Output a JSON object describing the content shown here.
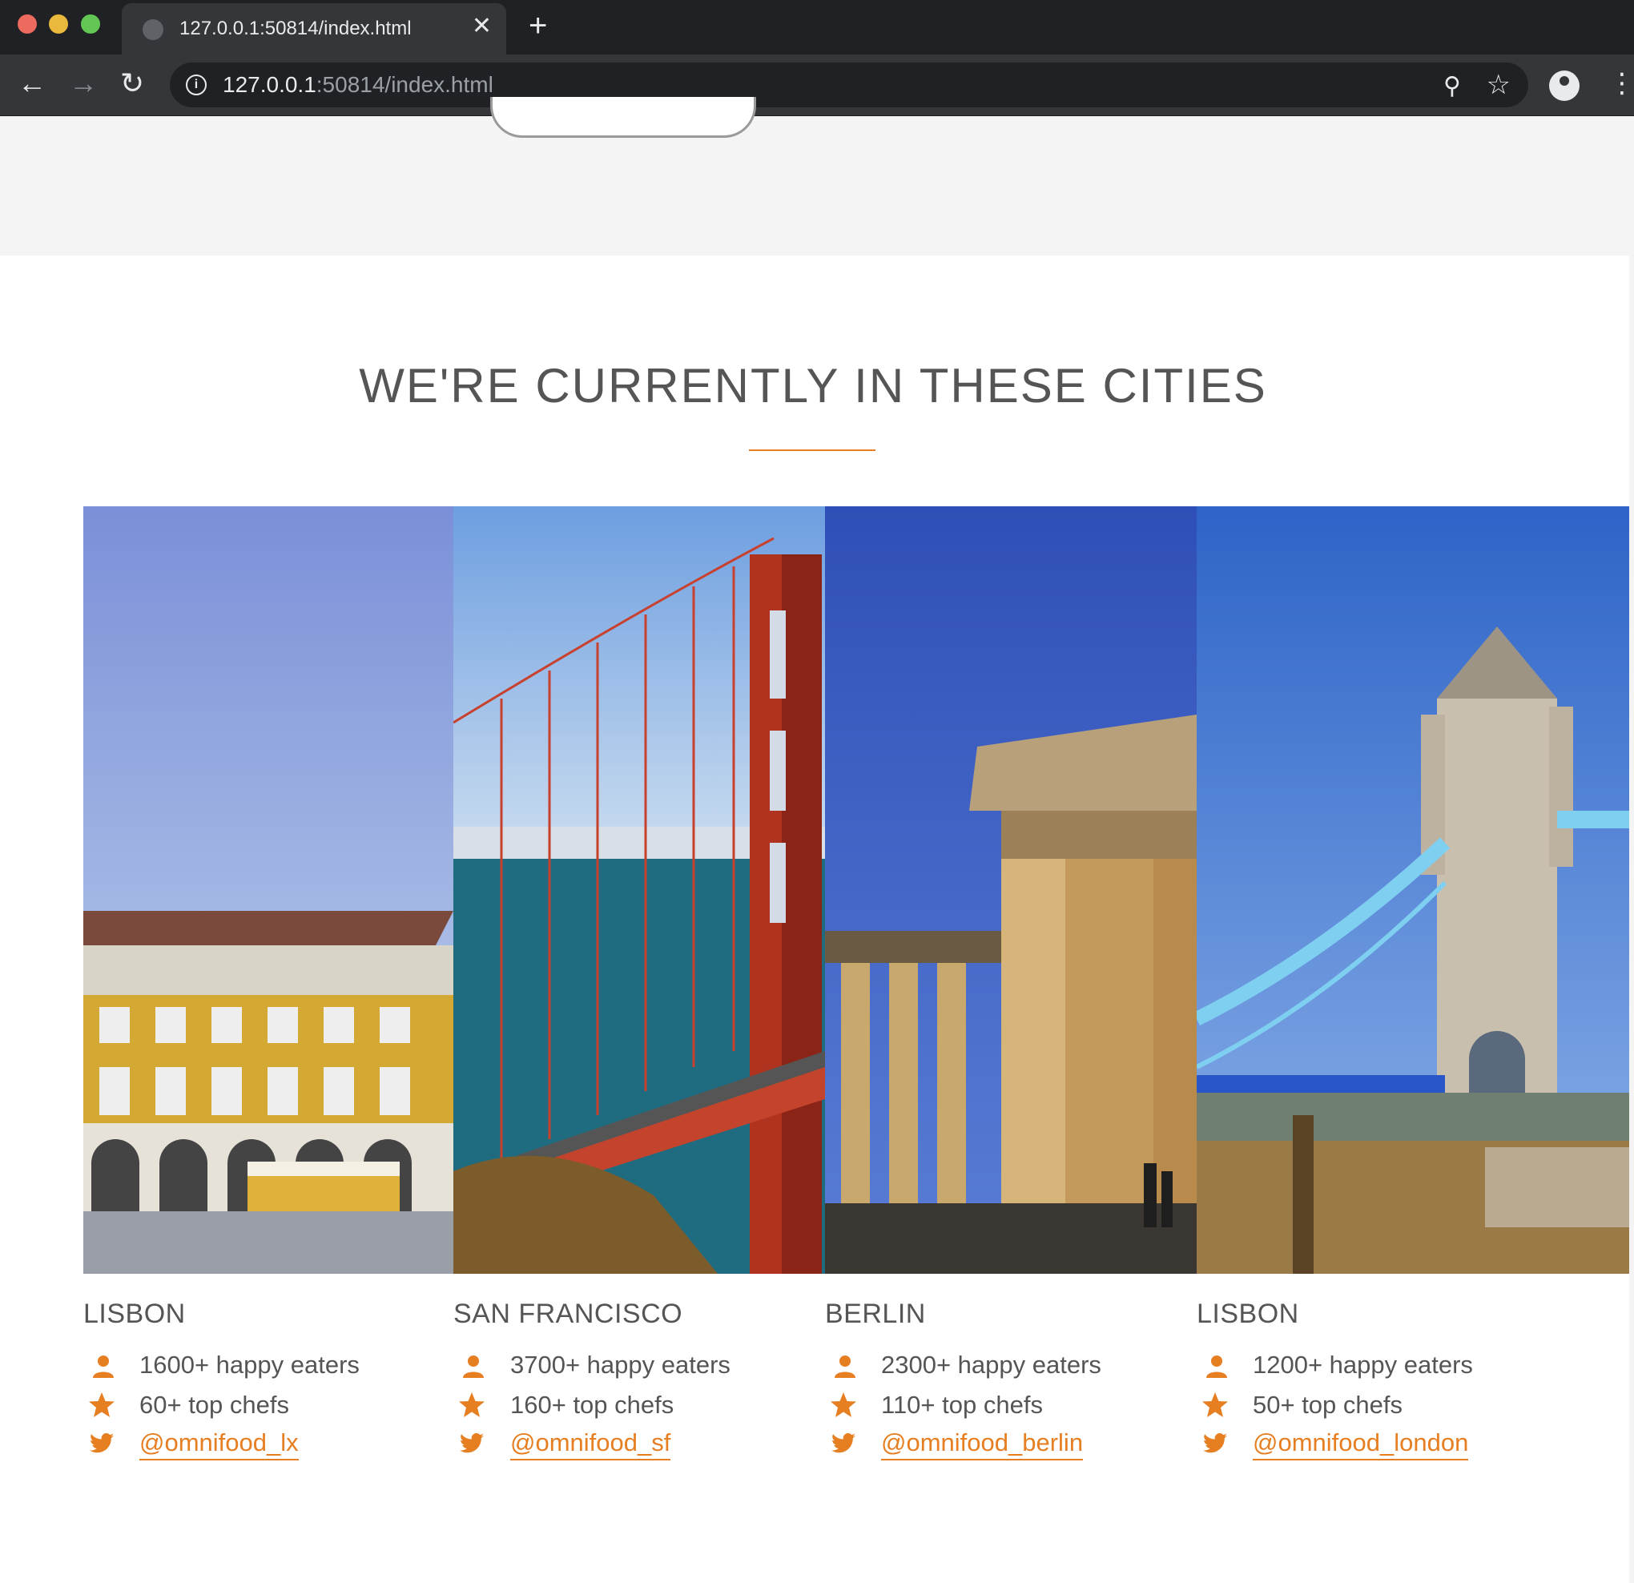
{
  "browser": {
    "tab_title": "127.0.0.1:50814/index.html",
    "url_host": "127.0.0.1",
    "url_rest": ":50814/index.html"
  },
  "section": {
    "title": "WE'RE CURRENTLY IN THESE CITIES"
  },
  "cities": [
    {
      "name": "LISBON",
      "eaters": "1600+ happy eaters",
      "chefs": "60+ top chefs",
      "twitter": "@omnifood_lx"
    },
    {
      "name": "SAN FRANCISCO",
      "eaters": "3700+ happy eaters",
      "chefs": "160+ top chefs",
      "twitter": "@omnifood_sf"
    },
    {
      "name": "BERLIN",
      "eaters": "2300+ happy eaters",
      "chefs": "110+ top chefs",
      "twitter": "@omnifood_berlin"
    },
    {
      "name": "LISBON",
      "eaters": "1200+ happy eaters",
      "chefs": "50+ top chefs",
      "twitter": "@omnifood_london"
    }
  ],
  "colors": {
    "accent": "#e67e22",
    "text": "#555555"
  },
  "icons": [
    "person-icon",
    "star-icon",
    "twitter-icon"
  ]
}
